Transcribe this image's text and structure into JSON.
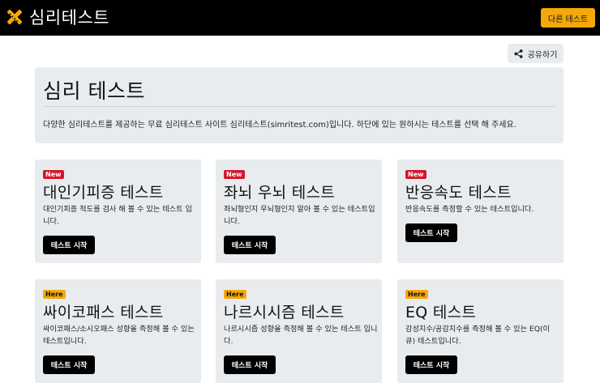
{
  "header": {
    "brand_title": "심리테스트",
    "brand_icon": "pencil-ruler-icon",
    "other_tests_label": "다른 테스트"
  },
  "share": {
    "label": "공유하기",
    "icon": "share-icon"
  },
  "hero": {
    "title": "심리 테스트",
    "description": "다양한 심리테스트를 제공하는 무료 심리테스트 사이트 심리테스트(simritest.com)입니다. 하단에 있는 원하시는 테스트를 선택 해 주세요."
  },
  "cards": [
    {
      "badge": "New",
      "title": "대인기피증 테스트",
      "desc": "대인기피증 척도를 검사 해 볼 수 있는 테스트 입니다.",
      "button": "테스트 시작"
    },
    {
      "badge": "New",
      "title": "좌뇌 우뇌 테스트",
      "desc": "좌뇌형인지 우뇌형인지 알아 볼 수 있는 테스트입니다.",
      "button": "테스트 시작"
    },
    {
      "badge": "New",
      "title": "반응속도 테스트",
      "desc": "반응속도를 측정할 수 있는 테스트입니다.",
      "button": "테스트 시작"
    },
    {
      "badge": "Here",
      "title": "싸이코패스 테스트",
      "desc": "싸이코패스/소시오패스 성향을 측정해 볼 수 있는 테스트입니다.",
      "button": "테스트 시작"
    },
    {
      "badge": "Here",
      "title": "나르시시즘 테스트",
      "desc": "나르시시즘 성향을 측정해 볼 수 있는 테스트 입니다.",
      "button": "테스트 시작"
    },
    {
      "badge": "Here",
      "title": "EQ 테스트",
      "desc": "감성지수/공감지수를 측정해 볼 수 있는 EQ(이큐) 테스트입니다.",
      "button": "테스트 시작"
    }
  ],
  "colors": {
    "topbar": "#000000",
    "accent": "#f5a80a",
    "new_badge": "#d9152b",
    "card_bg": "#e9ecef"
  }
}
